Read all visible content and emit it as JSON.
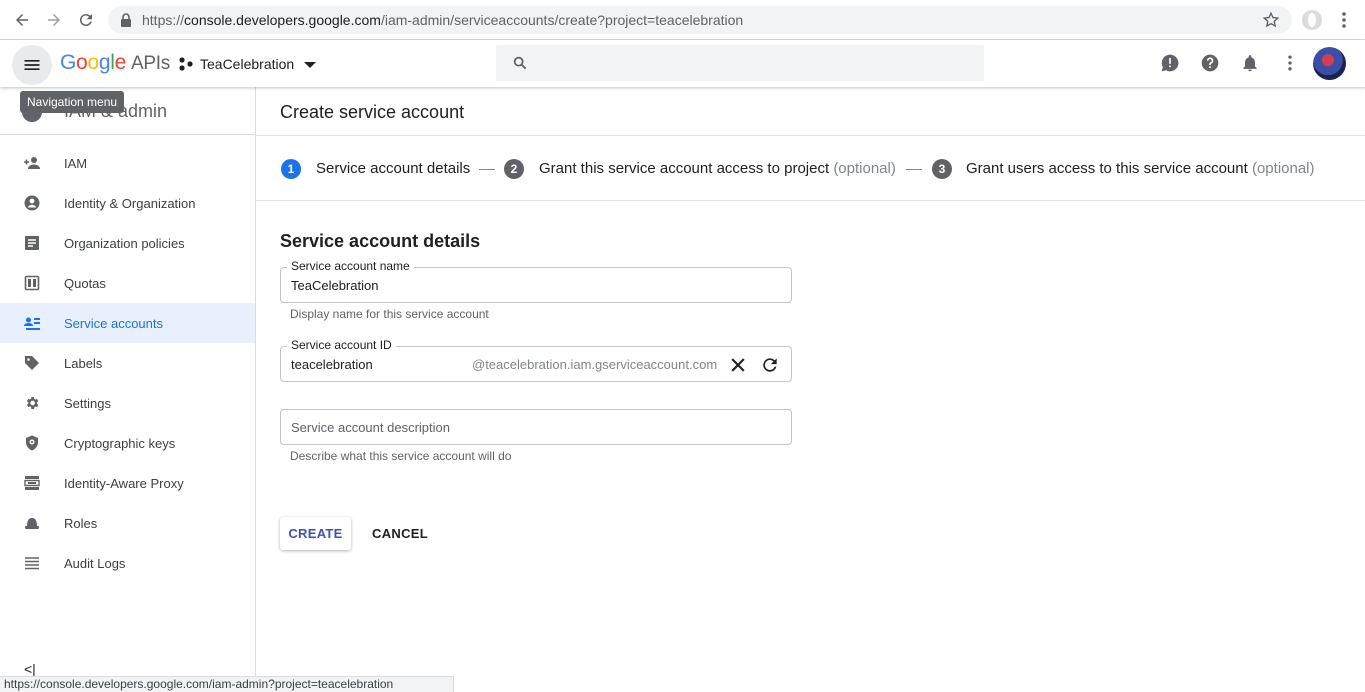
{
  "browser": {
    "url_prefix": "https://",
    "url_host": "console.developers.google.com",
    "url_path": "/iam-admin/serviceaccounts/create?project=teacelebration",
    "status_url": "https://console.developers.google.com/iam-admin?project=teacelebration"
  },
  "header": {
    "logo_g1": "G",
    "logo_g2": "o",
    "logo_g3": "o",
    "logo_g4": "g",
    "logo_g5": "l",
    "logo_g6": "e",
    "logo_suffix": "APIs",
    "project_name": "TeaCelebration",
    "tooltip": "Navigation menu"
  },
  "sidebar": {
    "title": "IAM & admin",
    "items": [
      {
        "label": "IAM",
        "icon": "person-add-icon"
      },
      {
        "label": "Identity & Organization",
        "icon": "account-circle-icon"
      },
      {
        "label": "Organization policies",
        "icon": "policy-doc-icon"
      },
      {
        "label": "Quotas",
        "icon": "quota-icon"
      },
      {
        "label": "Service accounts",
        "icon": "service-account-icon"
      },
      {
        "label": "Labels",
        "icon": "label-tag-icon"
      },
      {
        "label": "Settings",
        "icon": "gear-icon"
      },
      {
        "label": "Cryptographic keys",
        "icon": "shield-key-icon"
      },
      {
        "label": "Identity-Aware Proxy",
        "icon": "proxy-icon"
      },
      {
        "label": "Roles",
        "icon": "roles-hat-icon"
      },
      {
        "label": "Audit Logs",
        "icon": "list-lines-icon"
      }
    ],
    "active_index": 4,
    "collapse_label": "<|"
  },
  "main": {
    "page_title": "Create service account",
    "steps": [
      {
        "number": "1",
        "label": "Service account details",
        "optional": ""
      },
      {
        "number": "2",
        "label": "Grant this service account access to project",
        "optional": "(optional)"
      },
      {
        "number": "3",
        "label": "Grant users access to this service account",
        "optional": "(optional)"
      }
    ],
    "section_title": "Service account details",
    "name_field": {
      "label": "Service account name",
      "value": "TeaCelebration",
      "hint": "Display name for this service account"
    },
    "id_field": {
      "label": "Service account ID",
      "value": "teacelebration",
      "suffix": "@teacelebration.iam.gserviceaccount.com"
    },
    "description_field": {
      "placeholder": "Service account description",
      "hint": "Describe what this service account will do"
    },
    "create_label": "CREATE",
    "cancel_label": "CANCEL"
  },
  "colors": {
    "accent": "#1a73e8",
    "active_bg": "#e8f0fe",
    "button_text": "#3f51b5"
  }
}
